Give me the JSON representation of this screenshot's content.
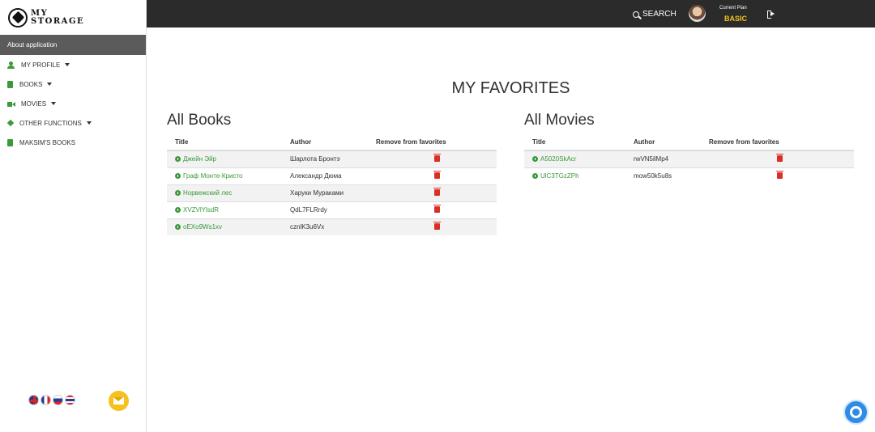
{
  "app": {
    "logo_line1": "MY",
    "logo_line2": "STORAGE"
  },
  "sidebar": {
    "about": "About application",
    "items": [
      {
        "label": "MY PROFILE",
        "icon": "user-icon",
        "has_caret": true
      },
      {
        "label": "BOOKS",
        "icon": "book-icon",
        "has_caret": true
      },
      {
        "label": "MOVIES",
        "icon": "video-camera-icon",
        "has_caret": true
      },
      {
        "label": "OTHER FUNCTIONS",
        "icon": "diamond-icon",
        "has_caret": true
      },
      {
        "label": "MAKSIM'S BOOKS",
        "icon": "book-icon",
        "has_caret": false
      }
    ],
    "languages": [
      "uk-flag-icon",
      "fr-flag-icon",
      "ru-flag-icon",
      "th-flag-icon"
    ]
  },
  "topbar": {
    "search_label": "SEARCH",
    "plan_label": "Current Plan",
    "plan_value": "BASIC"
  },
  "main": {
    "title": "MY FAVORITES",
    "books": {
      "title": "All Books",
      "columns": [
        "Title",
        "Author",
        "Remove from favorites"
      ],
      "rows": [
        {
          "title": "Джейн Эйр",
          "author": "Шарлота Бронтэ"
        },
        {
          "title": "Граф Монте-Кристо",
          "author": "Александр Дюма"
        },
        {
          "title": "Норвежский лес",
          "author": "Харуки Мураками"
        },
        {
          "title": "XVZVlYlsdR",
          "author": "QdL7FLRrdy"
        },
        {
          "title": "oEXo9Ws1xv",
          "author": "cznlK3u6Vx"
        }
      ]
    },
    "movies": {
      "title": "All Movies",
      "columns": [
        "Title",
        "Author",
        "Remove from favorites"
      ],
      "rows": [
        {
          "title": "A5020SkAcr",
          "author": "rwVN5ilMp4"
        },
        {
          "title": "UlC3TGzZPh",
          "author": "mow50k5u8s"
        }
      ]
    }
  },
  "colors": {
    "accent_green": "#3a9a3a",
    "delete_red": "#d93025",
    "plan_yellow": "#f4c21b",
    "topbar": "#2b2b2b"
  }
}
